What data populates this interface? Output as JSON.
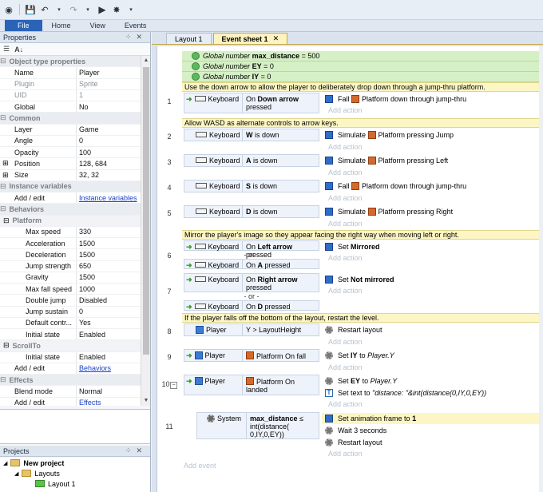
{
  "ribbon": {
    "tabs": [
      "File",
      "Home",
      "View",
      "Events"
    ]
  },
  "properties": {
    "title": "Properties",
    "rows": [
      {
        "type": "cat",
        "name": "Object type properties"
      },
      {
        "type": "row",
        "name": "Name",
        "value": "Player"
      },
      {
        "type": "row",
        "name": "Plugin",
        "value": "Sprite",
        "dim": true
      },
      {
        "type": "row",
        "name": "UID",
        "value": "1",
        "dim": true
      },
      {
        "type": "row",
        "name": "Global",
        "value": "No"
      },
      {
        "type": "cat",
        "name": "Common"
      },
      {
        "type": "row",
        "name": "Layer",
        "value": "Game"
      },
      {
        "type": "row",
        "name": "Angle",
        "value": "0"
      },
      {
        "type": "row",
        "name": "Opacity",
        "value": "100"
      },
      {
        "type": "row",
        "name": "Position",
        "value": "128, 684",
        "exp": true
      },
      {
        "type": "row",
        "name": "Size",
        "value": "32, 32",
        "exp": true
      },
      {
        "type": "cat",
        "name": "Instance variables"
      },
      {
        "type": "row",
        "name": "Add / edit",
        "value": "Instance variables",
        "link": true,
        "flat": true
      },
      {
        "type": "cat",
        "name": "Behaviors"
      },
      {
        "type": "subcat",
        "name": "Platform"
      },
      {
        "type": "sub",
        "name": "Max speed",
        "value": "330"
      },
      {
        "type": "sub",
        "name": "Acceleration",
        "value": "1500"
      },
      {
        "type": "sub",
        "name": "Deceleration",
        "value": "1500"
      },
      {
        "type": "sub",
        "name": "Jump strength",
        "value": "650"
      },
      {
        "type": "sub",
        "name": "Gravity",
        "value": "1500"
      },
      {
        "type": "sub",
        "name": "Max fall speed",
        "value": "1000"
      },
      {
        "type": "sub",
        "name": "Double jump",
        "value": "Disabled"
      },
      {
        "type": "sub",
        "name": "Jump sustain",
        "value": "0"
      },
      {
        "type": "sub",
        "name": "Default contr...",
        "value": "Yes"
      },
      {
        "type": "sub",
        "name": "Initial state",
        "value": "Enabled"
      },
      {
        "type": "subcat",
        "name": "ScrollTo"
      },
      {
        "type": "sub",
        "name": "Initial state",
        "value": "Enabled"
      },
      {
        "type": "row",
        "name": "Add / edit",
        "value": "Behaviors",
        "link": true,
        "flat": true
      },
      {
        "type": "cat",
        "name": "Effects"
      },
      {
        "type": "row",
        "name": "Blend mode",
        "value": "Normal"
      },
      {
        "type": "row",
        "name": "Add / edit",
        "value": "Effects",
        "link": true,
        "flat": true
      }
    ]
  },
  "projects": {
    "title": "Projects",
    "items": [
      "New project",
      "Layouts",
      "Layout 1"
    ]
  },
  "editor": {
    "tabs": [
      "Layout 1",
      "Event sheet 1"
    ],
    "globals": [
      {
        "prefix": "Global number",
        "name": "max_distance",
        "value": "= 500"
      },
      {
        "prefix": "Global number",
        "name": "EY",
        "value": "= 0"
      },
      {
        "prefix": "Global number",
        "name": "IY",
        "value": "= 0"
      }
    ],
    "comments": [
      "Use the down arrow to allow the player to deliberately drop down through a jump-thru platform.",
      "Allow WASD as alternate controls to arrow keys.",
      "Mirror the player's image so they appear facing the right way when moving left or right.",
      "If the player falls off the bottom of the layout, restart the level."
    ],
    "event_numbers": [
      "1",
      "2",
      "3",
      "4",
      "5",
      "6",
      "7",
      "8",
      "9",
      "10",
      "11"
    ],
    "keyboard": "Keyboard",
    "player": "Player",
    "system": "System",
    "add_action": "Add action",
    "add_event": "Add event",
    "or": "- or -",
    "e1": {
      "cond_a": "On",
      "cond_b": "Down arrow",
      "cond_c": "pressed",
      "act_a": "Fall",
      "act_b": "Platform down through jump-thru"
    },
    "e2": {
      "cond_a": "W",
      "cond_b": "is down",
      "act_a": "Simulate",
      "act_b": "Platform pressing Jump"
    },
    "e3": {
      "cond_a": "A",
      "cond_b": "is down",
      "act_a": "Simulate",
      "act_b": "Platform pressing Left"
    },
    "e4": {
      "cond_a": "S",
      "cond_b": "is down",
      "act_a": "Fall",
      "act_b": "Platform down through jump-thru"
    },
    "e5": {
      "cond_a": "D",
      "cond_b": "is down",
      "act_a": "Simulate",
      "act_b": "Platform pressing Right"
    },
    "e6": {
      "c1a": "On",
      "c1b": "Left arrow",
      "c1c": "pressed",
      "c2a": "On",
      "c2b": "A",
      "c2c": "pressed",
      "act_a": "Set",
      "act_b": "Mirrored"
    },
    "e7": {
      "c1a": "On",
      "c1b": "Right arrow",
      "c1c": "pressed",
      "c2a": "On",
      "c2b": "D",
      "c2c": "pressed",
      "act_a": "Set",
      "act_b": "Not mirrored"
    },
    "e8": {
      "cond": "Y > LayoutHeight",
      "act": "Restart layout"
    },
    "e9": {
      "cond": "Platform On fall",
      "act_a": "Set",
      "act_b": "IY",
      "act_c": "to",
      "act_d": "Player.Y"
    },
    "e10": {
      "cond_a": "Platform On",
      "cond_b": "landed",
      "act1_a": "Set",
      "act1_b": "EY",
      "act1_c": "to",
      "act1_d": "Player.Y",
      "act2_a": "Set text to",
      "act2_b": "\"distance: \"&int(distance(0,IY,0,EY))"
    },
    "e11": {
      "cond_a": "max_distance",
      "cond_b": "≤",
      "cond_c": "int(distance(",
      "cond_d": "0,IY,0,EY))",
      "act1_a": "Set animation frame to",
      "act1_b": "1",
      "act2": "Wait 3 seconds",
      "act3": "Restart layout"
    }
  }
}
